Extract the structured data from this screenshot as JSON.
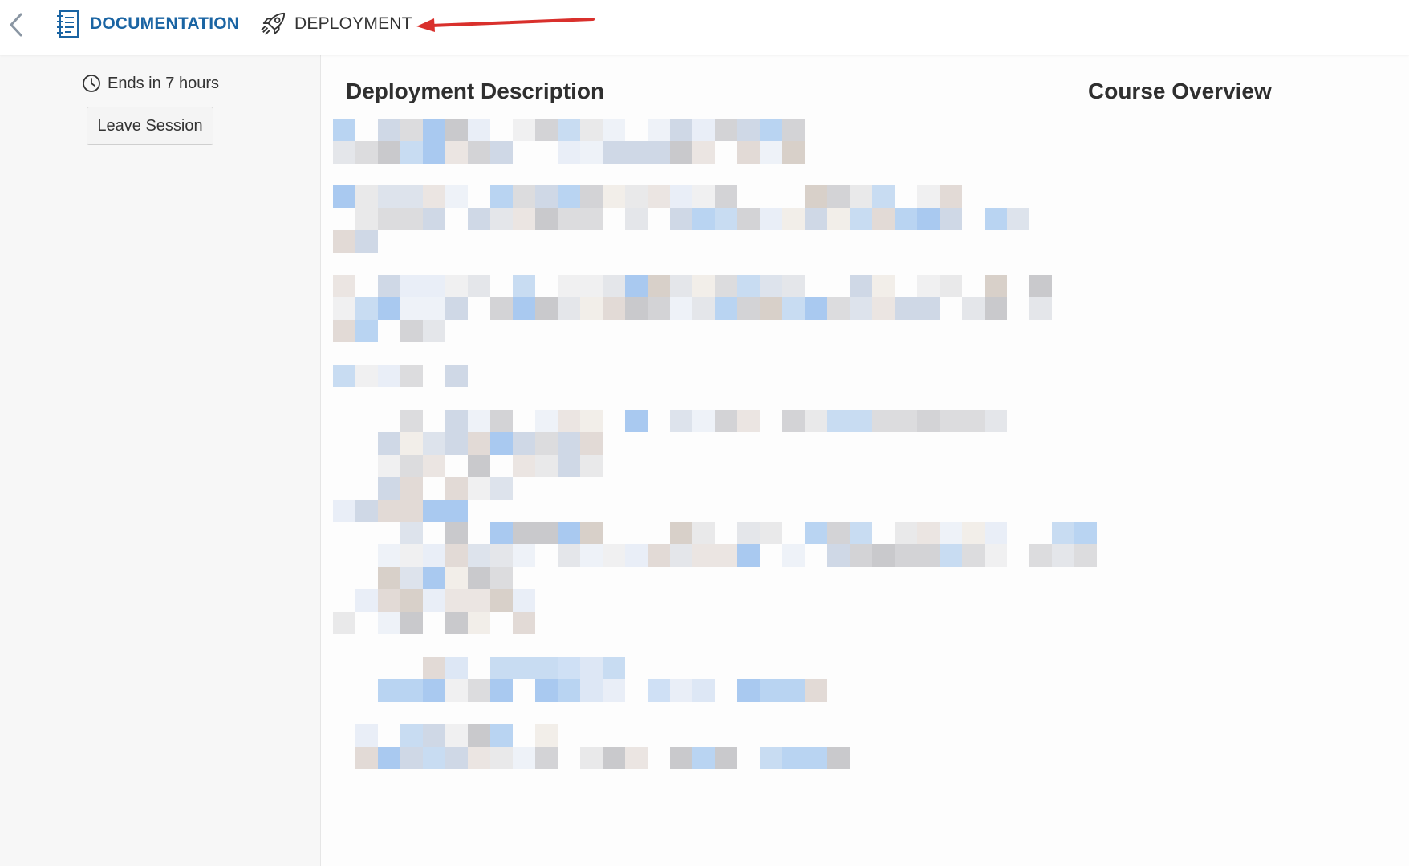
{
  "header": {
    "back_icon": "chevron-left-icon",
    "tabs": [
      {
        "label": "DOCUMENTATION",
        "icon": "notebook-icon",
        "active": true
      },
      {
        "label": "DEPLOYMENT",
        "icon": "rocket-icon",
        "active": false
      }
    ],
    "annotation_arrow_color": "#d9302c",
    "accent_color": "#1a64a3"
  },
  "sidebar": {
    "timer_icon": "clock-icon",
    "timer_text": "Ends in 7 hours",
    "leave_button_label": "Leave Session"
  },
  "main": {
    "description_heading": "Deployment Description",
    "overview_heading": "Course Overview"
  }
}
